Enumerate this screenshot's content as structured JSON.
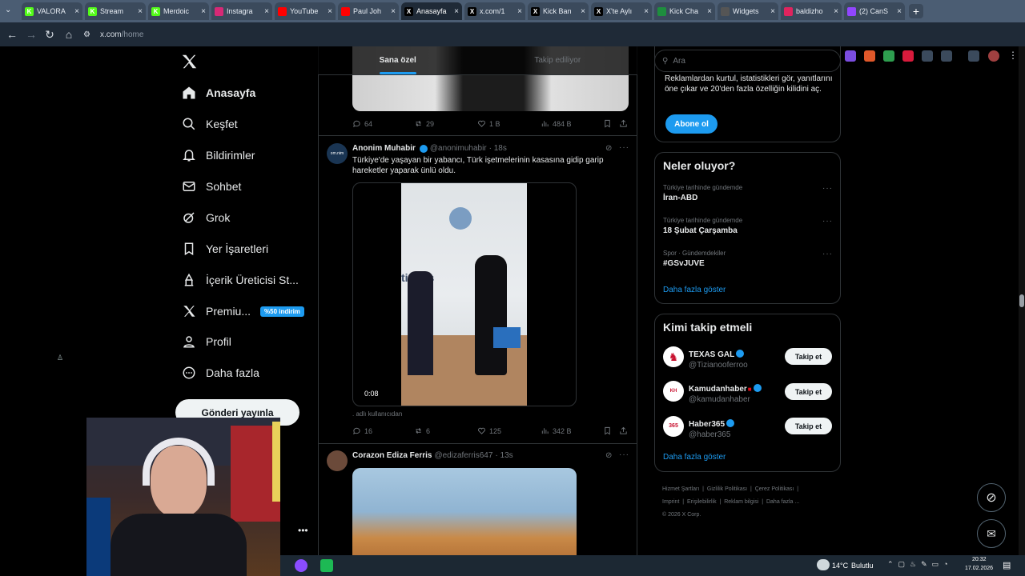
{
  "browser": {
    "tabs": [
      {
        "title": "VALORA",
        "fav_color": "#53fc18",
        "fav_text": "K"
      },
      {
        "title": "Stream",
        "fav_color": "#53fc18",
        "fav_text": "K"
      },
      {
        "title": "Merdoic",
        "fav_color": "#53fc18",
        "fav_text": "K"
      },
      {
        "title": "Instagra",
        "fav_color": "#d62976",
        "fav_text": ""
      },
      {
        "title": "YouTube",
        "fav_color": "#ff0000",
        "fav_text": ""
      },
      {
        "title": "Paul Joh",
        "fav_color": "#ff0000",
        "fav_text": ""
      },
      {
        "title": "Anasayfa",
        "fav_color": "#000000",
        "fav_text": "X"
      },
      {
        "title": "x.com/1",
        "fav_color": "#000000",
        "fav_text": "X"
      },
      {
        "title": "Kick Ban",
        "fav_color": "#000000",
        "fav_text": "X"
      },
      {
        "title": "X'te Aylı",
        "fav_color": "#000000",
        "fav_text": "X"
      },
      {
        "title": "Kick Cha",
        "fav_color": "#1e8e3e",
        "fav_text": ""
      },
      {
        "title": "Widgets",
        "fav_color": "#555555",
        "fav_text": ""
      },
      {
        "title": "baldizho",
        "fav_color": "#e0245e",
        "fav_text": ""
      },
      {
        "title": "(2) CanS",
        "fav_color": "#9146ff",
        "fav_text": ""
      }
    ],
    "url_host": "x.com",
    "url_path": "/home"
  },
  "nav": {
    "home": "Anasayfa",
    "explore": "Keşfet",
    "notifications": "Bildirimler",
    "chat": "Sohbet",
    "grok": "Grok",
    "bookmarks": "Yer İşaretleri",
    "creator": "İçerik Üreticisi St...",
    "premium": "Premiu...",
    "premium_badge": "%50 indirim",
    "profile": "Profil",
    "more": "Daha fazla",
    "post": "Gönderi yayınla"
  },
  "feed": {
    "tab_for_you": "Sana özel",
    "tab_following": "Takip ediliyor",
    "top_tweet": {
      "replies": "64",
      "reposts": "29",
      "likes": "1 B",
      "views": "484 B"
    },
    "tweet1": {
      "name": "Anonim Muhabir",
      "handle": "@anonimuhabir",
      "time": "· 18s",
      "text": "Türkiye'de yaşayan bir yabancı, Türk işetmelerinin kasasına gidip garip hareketler yaparak ünlü oldu.",
      "video_time": "0:08",
      "source_note": ". adlı kullanıcıdan",
      "replies": "16",
      "reposts": "6",
      "likes": "125",
      "views": "342 B"
    },
    "tweet2": {
      "name": "Corazon Ediza Ferris",
      "handle": "@edizaferris647",
      "time": "· 13s"
    }
  },
  "right": {
    "search_placeholder": "Ara",
    "premium_text": "Reklamlardan kurtul, istatistikleri gör, yanıtlarını öne çıkar ve 20'den fazla özelliğin kilidini aç.",
    "subscribe": "Abone ol",
    "trends_title": "Neler oluyor?",
    "trends": [
      {
        "context": "Türkiye tarihinde gündemde",
        "name": "İran-ABD"
      },
      {
        "context": "Türkiye tarihinde gündemde",
        "name": "18 Şubat Çarşamba"
      },
      {
        "context": "Spor · Gündemdekiler",
        "name": "#GSvJUVE"
      }
    ],
    "show_more": "Daha fazla göster",
    "who_title": "Kimi takip etmeli",
    "who": [
      {
        "name": "TEXAS GAL",
        "handle": "@Tizianooferroo",
        "avatar_color": "#ffffff"
      },
      {
        "name": "Kamudanhaber",
        "handle": "@kamudanhaber",
        "avatar_color": "#ffffff"
      },
      {
        "name": "Haber365",
        "handle": "@haber365",
        "avatar_color": "#ffffff"
      }
    ],
    "follow": "Takip et",
    "footer1": [
      "Hizmet Şartları",
      "Gizlilik Politikası",
      "Çerez Politikası"
    ],
    "footer2": [
      "Imprint",
      "Erişilebilirlik",
      "Reklam bilgisi",
      "Daha fazla ..."
    ],
    "copyright": "© 2026 X Corp."
  },
  "taskbar": {
    "temp": "14°C",
    "weather": "Bulutlu",
    "time": "20:32",
    "date": "17.02.2026"
  }
}
